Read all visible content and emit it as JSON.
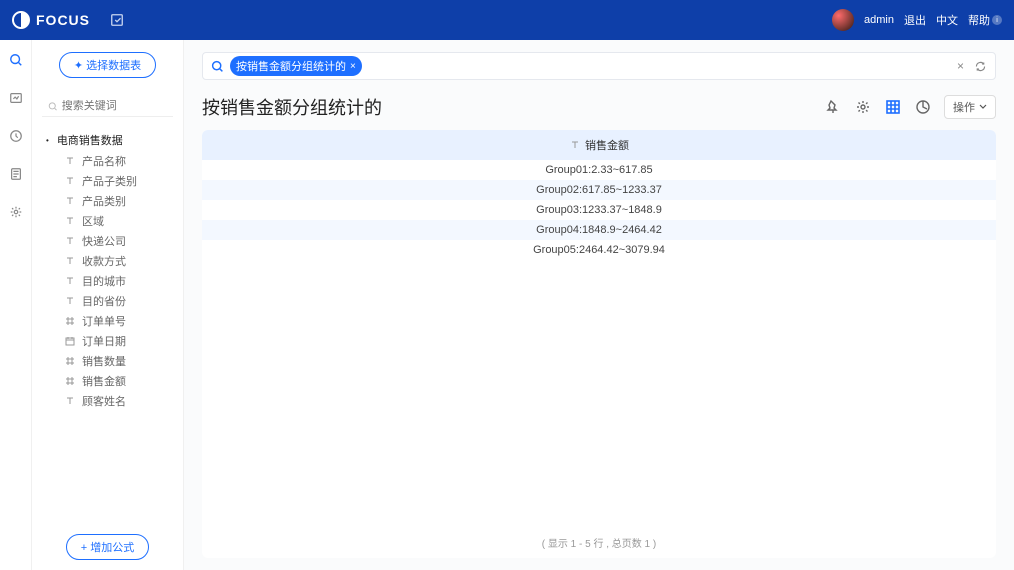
{
  "header": {
    "logo_text": "FOCUS",
    "user": "admin",
    "logout": "退出",
    "lang": "中文",
    "help": "帮助"
  },
  "sidebar": {
    "select_btn": "选择数据表",
    "search_placeholder": "搜索关键词",
    "root": "电商销售数据",
    "items": [
      {
        "type": "T",
        "label": "产品名称"
      },
      {
        "type": "T",
        "label": "产品子类别"
      },
      {
        "type": "T",
        "label": "产品类别"
      },
      {
        "type": "T",
        "label": "区域"
      },
      {
        "type": "T",
        "label": "快递公司"
      },
      {
        "type": "T",
        "label": "收款方式"
      },
      {
        "type": "T",
        "label": "目的城市"
      },
      {
        "type": "T",
        "label": "目的省份"
      },
      {
        "type": "N",
        "label": "订单单号"
      },
      {
        "type": "D",
        "label": "订单日期"
      },
      {
        "type": "N",
        "label": "销售数量"
      },
      {
        "type": "N",
        "label": "销售金额"
      },
      {
        "type": "T",
        "label": "顾客姓名"
      }
    ],
    "add_formula": "增加公式"
  },
  "search": {
    "chip": "按销售金额分组统计的"
  },
  "title": "按销售金额分组统计的",
  "actions": {
    "operate": "操作"
  },
  "table": {
    "header": "销售金额",
    "rows": [
      "Group01:2.33~617.85",
      "Group02:617.85~1233.37",
      "Group03:1233.37~1848.9",
      "Group04:1848.9~2464.42",
      "Group05:2464.42~3079.94"
    ],
    "footer": "( 显示 1 - 5 行 , 总页数 1 )"
  },
  "chart_data": {
    "type": "table",
    "title": "按销售金额分组统计的",
    "columns": [
      "销售金额"
    ],
    "rows": [
      {
        "group": "Group01",
        "range": [
          2.33,
          617.85
        ]
      },
      {
        "group": "Group02",
        "range": [
          617.85,
          1233.37
        ]
      },
      {
        "group": "Group03",
        "range": [
          1233.37,
          1848.9
        ]
      },
      {
        "group": "Group04",
        "range": [
          1848.9,
          2464.42
        ]
      },
      {
        "group": "Group05",
        "range": [
          2464.42,
          3079.94
        ]
      }
    ]
  }
}
